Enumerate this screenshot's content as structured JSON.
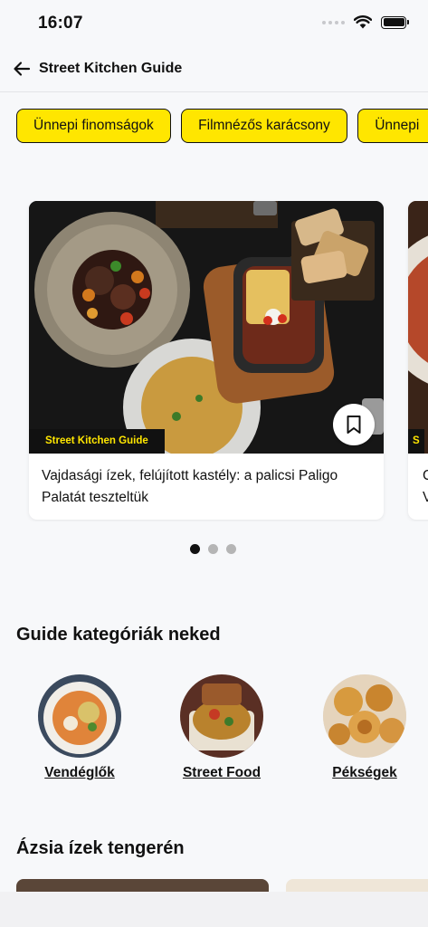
{
  "status_bar": {
    "time": "16:07"
  },
  "header": {
    "title": "Street Kitchen Guide"
  },
  "chips": [
    "Ünnepi finomságok",
    "Filmnézős karácsony",
    "Ünnepi"
  ],
  "carousel": {
    "cards": [
      {
        "tag": "Street Kitchen Guide",
        "title": "Vajdasági ízek, felújított kastély: a palicsi Paligo Palatát teszteltük"
      },
      {
        "tag": "S",
        "title": "C\nV"
      }
    ],
    "pagination": {
      "total": 3,
      "active": 1
    }
  },
  "categories_section": {
    "title": "Guide kategóriák neked",
    "items": [
      {
        "label": "Vendéglők"
      },
      {
        "label": "Street Food"
      },
      {
        "label": "Pékségek"
      }
    ]
  },
  "asia_section": {
    "title": "Ázsia ízek tengerén"
  }
}
